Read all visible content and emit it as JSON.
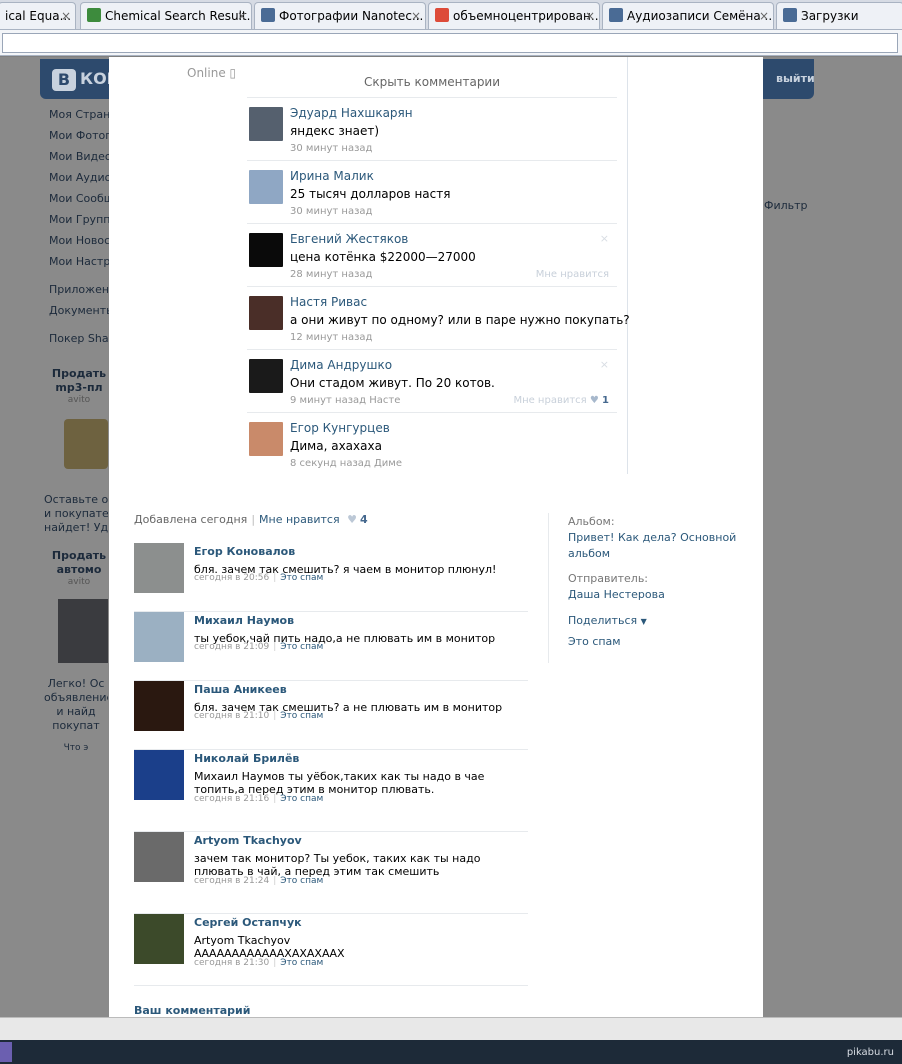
{
  "browser": {
    "tabs": [
      {
        "label": "ical Equa...",
        "icon": "document-icon",
        "color": "#6f7e95"
      },
      {
        "label": "Chemical Search Result...",
        "icon": "flask-icon",
        "color": "#3d8b3d"
      },
      {
        "label": "Фотографии Nanotec...",
        "icon": "vk-icon",
        "color": "#4a6b95"
      },
      {
        "label": "объемноцентрирован...",
        "icon": "google-icon",
        "color": "#dd4b39"
      },
      {
        "label": "Аудиозаписи Семёна ...",
        "icon": "vk-icon",
        "color": "#4a6b95"
      },
      {
        "label": "Загрузки",
        "icon": "downloads-icon",
        "color": "#4a6b95"
      }
    ]
  },
  "background_page": {
    "logo_text": "КОН",
    "exit_label": "выйти",
    "menu": [
      "Моя Страни",
      "Мои Фотогр",
      "Мои Видеоз",
      "Мои Аудиоз",
      "Мои Сообщ",
      "Мои Группы",
      "Мои Новост",
      "Мои Настро",
      "Приложени",
      "Документы",
      "Покер Shark"
    ],
    "filter_label": "Фильтр",
    "ads": [
      "Продать",
      "mp3-пл",
      "avito",
      "Оставьте об",
      "и покупател",
      "найдет! Уд",
      "Продать",
      "автомо",
      "avito",
      "Легко! Ос",
      "объявление",
      "и найд",
      "покупат",
      "Что э"
    ]
  },
  "viewer": {
    "online_label": "Online",
    "hide_comments": "Скрыть комментарии",
    "comments": [
      {
        "name": "Эдуард Нахшкарян",
        "text": "яндекс знает)",
        "time": "30 минут назад",
        "like": "",
        "count": "",
        "avatar": "#55606e"
      },
      {
        "name": "Ирина Малик",
        "text": "25 тысяч долларов настя",
        "time": "30 минут назад",
        "like": "",
        "count": "",
        "avatar": "#8fa7c4"
      },
      {
        "name": "Евгений Жестяков",
        "text": "цена котёнка $22000—27000",
        "time": "28 минут назад",
        "like": "Мне нравится",
        "count": "",
        "avatar": "#0a0a0a"
      },
      {
        "name": "Настя Ривас",
        "text": "а они живут по одному? или в паре нужно покупать?",
        "time": "12 минут назад",
        "like": "",
        "count": "",
        "avatar": "#4a2e28"
      },
      {
        "name": "Дима Андрушко",
        "text": "Они стадом живут. По 20 котов.",
        "time": "9 минут назад Насте",
        "like": "Мне нравится",
        "count": "1",
        "avatar": "#1a1a1a"
      },
      {
        "name": "Егор Кунгурцев",
        "text": "Дима, ахахаха",
        "time": "8 секунд назад Диме",
        "like": "",
        "count": "",
        "avatar": "#c98a6a"
      }
    ],
    "photo_info": {
      "added": "Добавлена сегодня",
      "like_label": "Мне нравится",
      "like_count": "4"
    },
    "photo_comments": [
      {
        "name": "Егор Коновалов",
        "text": "бля. зачем так смешить? я чаем в монитор плюнул!",
        "time": "сегодня в 20:56",
        "spam": "Это спам",
        "avatar": "#8c8f8e"
      },
      {
        "name": "Михаил Наумов",
        "text": "ты уебок,чай пить надо,а не плювать им в монитор",
        "time": "сегодня в 21:09",
        "spam": "Это спам",
        "avatar": "#9bb0c2"
      },
      {
        "name": "Паша Аникеев",
        "text": "бля. зачем так смешить? а не плювать им в монитор",
        "time": "сегодня в 21:10",
        "spam": "Это спам",
        "avatar": "#2a1810"
      },
      {
        "name": "Николай Брилёв",
        "text": "Михаил Наумов ты уёбок,таких как ты надо в чае топить,а перед этим в монитор плювать.",
        "time": "сегодня в 21:16",
        "spam": "Это спам",
        "avatar": "#1b3f8a"
      },
      {
        "name": "Artyom Tkachyov",
        "text": "зачем так монитор? Ты уебок, таких как ты надо плювать в чай, а перед этим так смешить",
        "time": "сегодня в 21:24",
        "spam": "Это спам",
        "avatar": "#6a6a6a"
      },
      {
        "name": "Сергей Остапчук",
        "text": "Artyom Tkachyov\nААААААААААААХАХАХААХ",
        "time": "сегодня в 21:30",
        "spam": "Это спам",
        "avatar": "#3c4a2a"
      }
    ],
    "your_comment": "Ваш комментарий",
    "side": {
      "album_label": "Альбом:",
      "album_link": "Привет! Как дела? Основной альбом",
      "sender_label": "Отправитель:",
      "sender_link": "Даша Нестерова",
      "share": "Поделиться",
      "spam": "Это спам"
    }
  },
  "taskbar": {
    "watermark": "pikabu.ru"
  }
}
